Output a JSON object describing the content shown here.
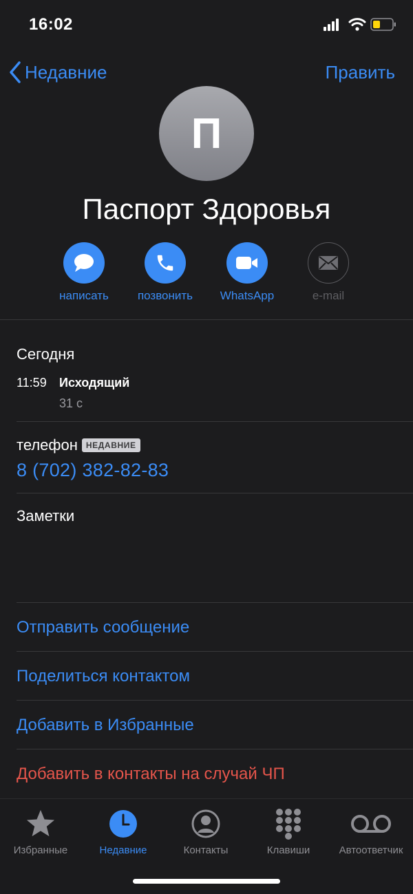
{
  "status": {
    "time": "16:02"
  },
  "nav": {
    "back_label": "Недавние",
    "edit_label": "Править"
  },
  "contact": {
    "initial": "П",
    "name": "Паспорт Здоровья"
  },
  "actions": [
    {
      "label": "написать",
      "icon": "message-icon",
      "enabled": true
    },
    {
      "label": "позвонить",
      "icon": "phone-icon",
      "enabled": true
    },
    {
      "label": "WhatsApp",
      "icon": "video-icon",
      "enabled": true
    },
    {
      "label": "e-mail",
      "icon": "mail-icon",
      "enabled": false
    }
  ],
  "recents": {
    "day": "Сегодня",
    "call": {
      "time": "11:59",
      "direction": "Исходящий",
      "duration": "31 с"
    }
  },
  "phone": {
    "label": "телефон",
    "badge": "НЕДАВНИЕ",
    "number": "8 (702) 382-82-83"
  },
  "notes": {
    "label": "Заметки"
  },
  "links": {
    "send_message": "Отправить сообщение",
    "share_contact": "Поделиться контактом",
    "add_favorites": "Добавить в Избранные",
    "emergency": "Добавить в контакты на случай ЧП"
  },
  "tabs": [
    {
      "label": "Избранные",
      "icon": "star-icon",
      "active": false
    },
    {
      "label": "Недавние",
      "icon": "clock-icon",
      "active": true
    },
    {
      "label": "Контакты",
      "icon": "person-icon",
      "active": false
    },
    {
      "label": "Клавиши",
      "icon": "keypad-icon",
      "active": false
    },
    {
      "label": "Автоответчик",
      "icon": "voicemail-icon",
      "active": false
    }
  ],
  "colors": {
    "accent": "#3b8cf5",
    "destructive": "#e5554b",
    "background": "#1c1c1e"
  }
}
